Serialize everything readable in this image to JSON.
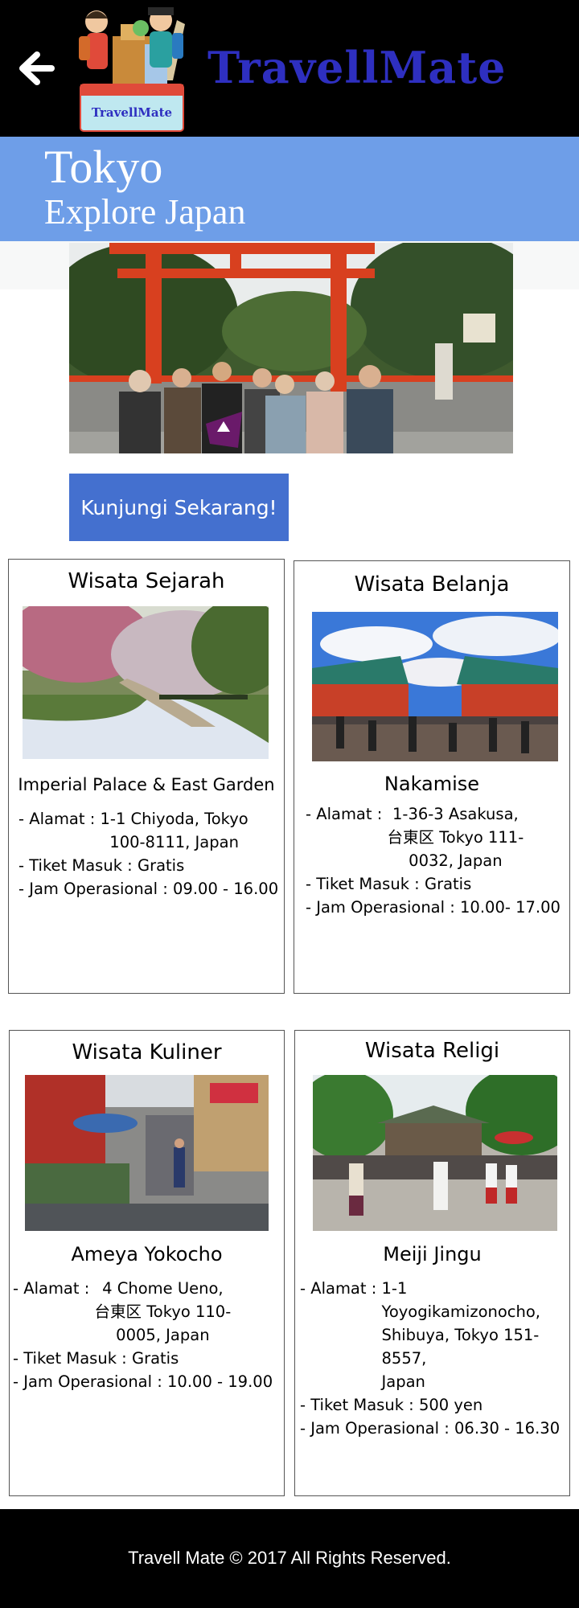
{
  "header": {
    "brand": "TravellMate",
    "logo_text": "TravellMate",
    "back_icon": "arrow-left-icon"
  },
  "banner": {
    "city": "Tokyo",
    "subtitle": "Explore Japan"
  },
  "cta_label": "Kunjungi Sekarang!",
  "cards": [
    {
      "category": "Wisata Sejarah",
      "place": "Imperial Palace & East Garden",
      "address_label": "- Alamat : ",
      "address": "1-1 Chiyoda, Tokyo\n100-8111, Japan",
      "ticket": "- Tiket Masuk : Gratis",
      "hours": "- Jam Operasional : 09.00 - 16.00"
    },
    {
      "category": "Wisata Belanja",
      "place": "Nakamise",
      "address_label": "- Alamat : ",
      "address": "1-36-3 Asakusa,\n台東区 Tokyo 111-\n0032, Japan",
      "ticket": "- Tiket Masuk : Gratis",
      "hours": "- Jam Operasional : 10.00- 17.00"
    },
    {
      "category": "Wisata Kuliner",
      "place": "Ameya Yokocho",
      "address_label": "- Alamat : ",
      "address": "4 Chome Ueno,\n台東区 Tokyo 110-\n0005, Japan",
      "ticket": "- Tiket Masuk : Gratis",
      "hours": "- Jam Operasional : 10.00 - 19.00"
    },
    {
      "category": "Wisata Religi",
      "place": "Meiji Jingu",
      "address_label": "- Alamat : ",
      "address": "1-1 Yoyogikamizonocho,\nShibuya, Tokyo 151-8557,\nJapan",
      "ticket": "- Tiket Masuk : 500 yen",
      "hours": "- Jam Operasional : 06.30 - 16.30"
    }
  ],
  "footer": "Travell Mate © 2017 All Rights Reserved.",
  "colors": {
    "header_bg": "#000000",
    "brand": "#2e2fc0",
    "banner_bg": "#6e9ee8",
    "cta_bg": "#4470cf"
  }
}
